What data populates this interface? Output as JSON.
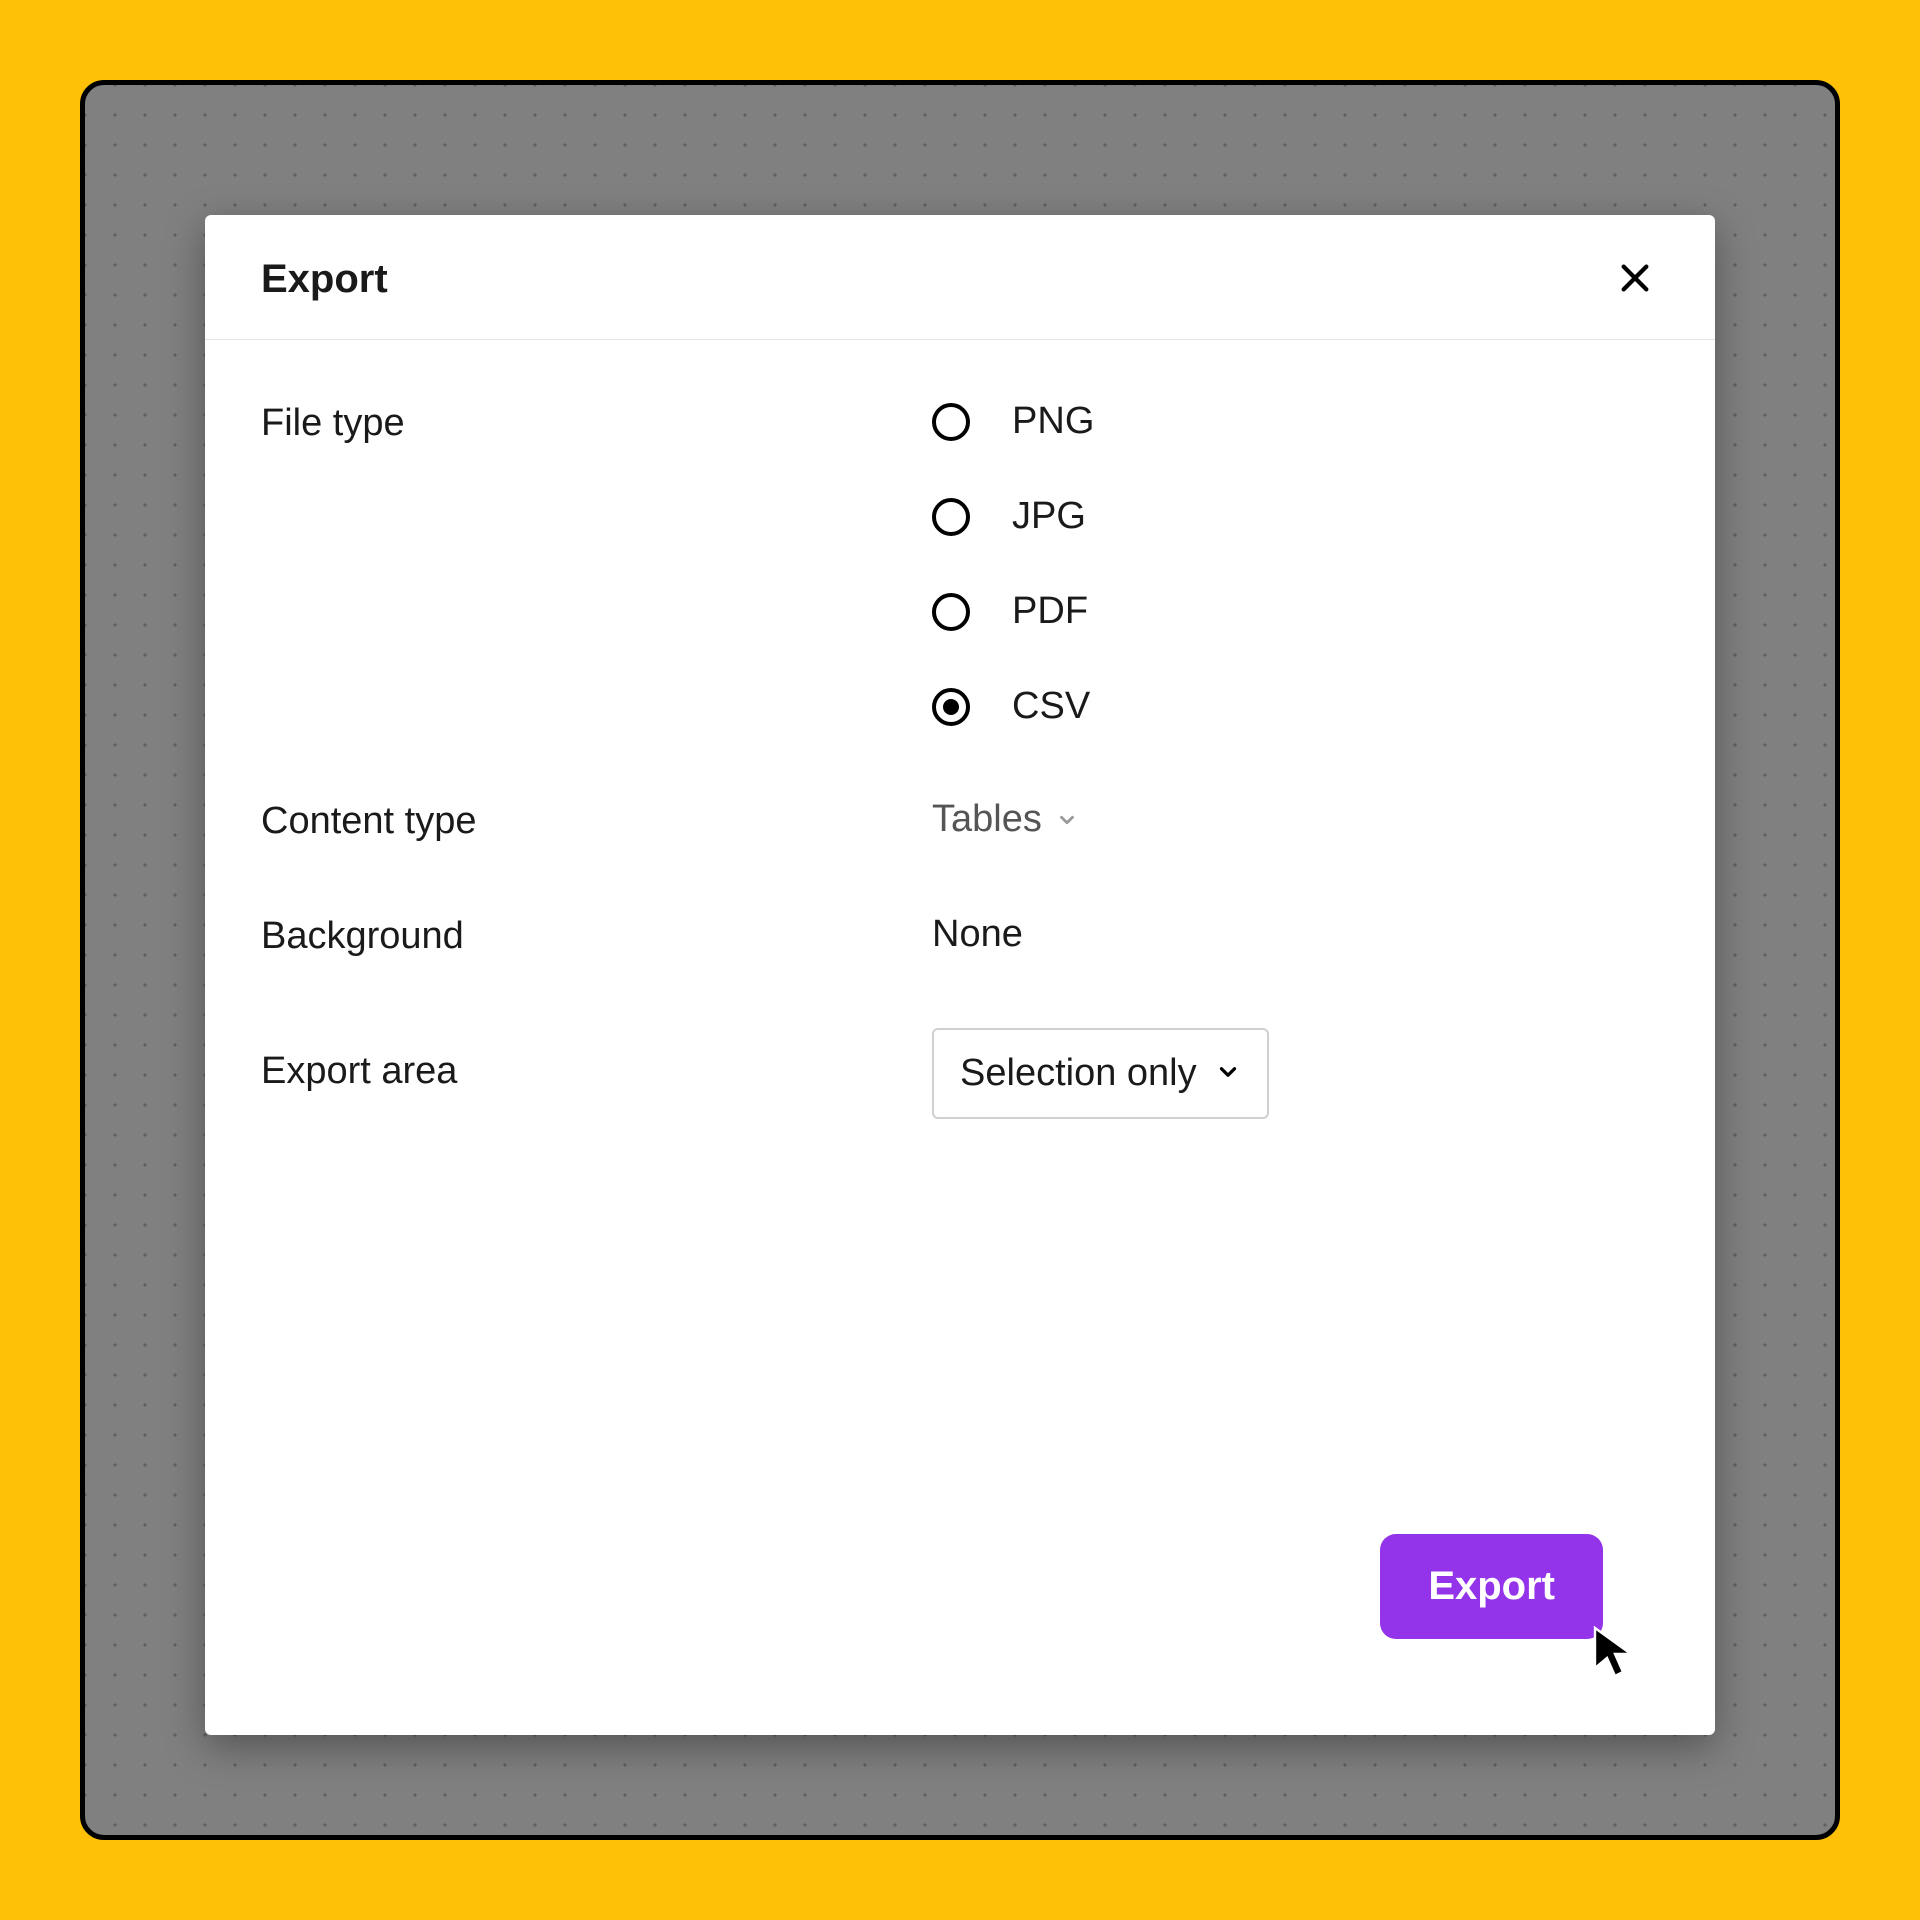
{
  "dialog": {
    "title": "Export",
    "file_type": {
      "label": "File type",
      "options": [
        "PNG",
        "JPG",
        "PDF",
        "CSV"
      ],
      "selected": "CSV"
    },
    "content_type": {
      "label": "Content type",
      "value": "Tables"
    },
    "background": {
      "label": "Background",
      "value": "None"
    },
    "export_area": {
      "label": "Export area",
      "value": "Selection only"
    },
    "submit_label": "Export"
  },
  "colors": {
    "accent": "#9333EA",
    "page_bg": "#FFC107",
    "frame_bg": "#808080"
  }
}
